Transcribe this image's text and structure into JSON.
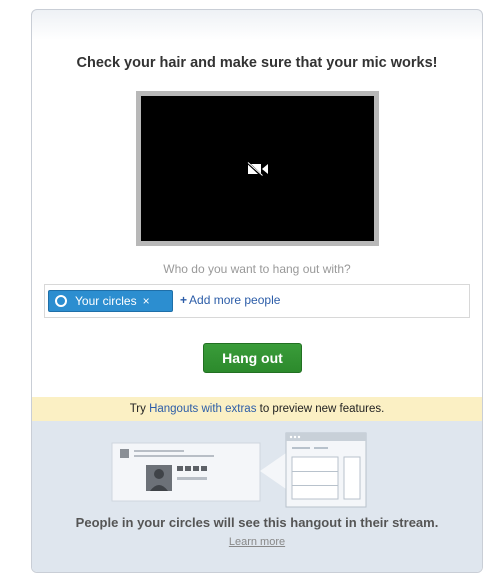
{
  "headline": "Check your hair and make sure that your mic works!",
  "video": {
    "camera_icon": "camera-off-icon"
  },
  "invite": {
    "question": "Who do you want to hang out with?",
    "chip_label": "Your circles",
    "chip_remove": "×",
    "add_plus": "+",
    "add_more": "Add more people"
  },
  "hangout_button": "Hang out",
  "extras": {
    "prefix": "Try ",
    "link": "Hangouts with extras",
    "suffix": " to preview new features."
  },
  "stream_notice": "People in your circles will see this hangout in their stream.",
  "learn_more": "Learn more",
  "colors": {
    "accent_blue": "#2c8ed0",
    "button_green": "#2c8a2c",
    "notice_yellow": "#fbf0c4",
    "bottom_bg": "#dfe6ee"
  }
}
